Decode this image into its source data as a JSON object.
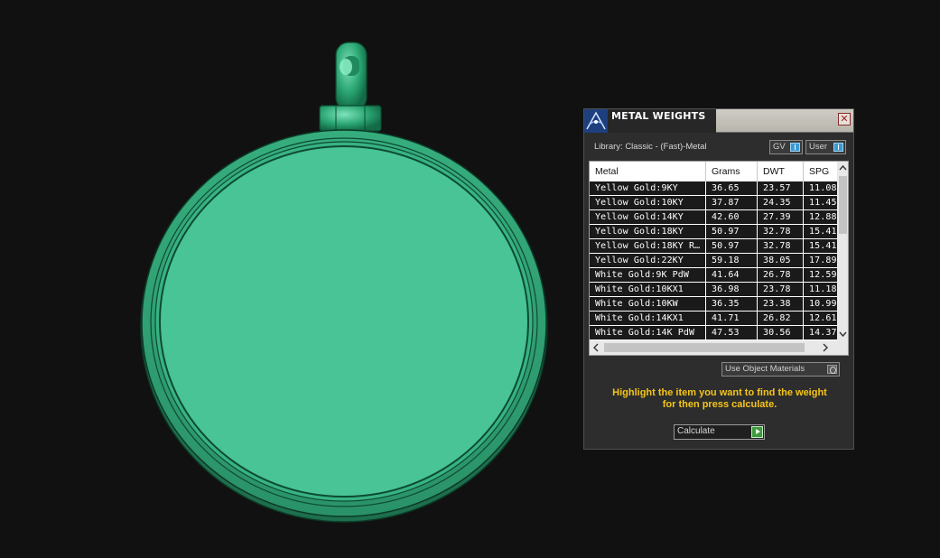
{
  "panel": {
    "title": "METAL WEIGHTS",
    "close_glyph": "✕",
    "library_label": "Library: Classic - (Fast)-Metal",
    "toggle_gv": "GV",
    "toggle_user": "User",
    "columns": [
      "Metal",
      "Grams",
      "DWT",
      "SPG"
    ],
    "rows": [
      {
        "metal": "Yellow Gold:9KY",
        "grams": "36.65",
        "dwt": "23.57",
        "spg": "11.08"
      },
      {
        "metal": "Yellow Gold:10KY",
        "grams": "37.87",
        "dwt": "24.35",
        "spg": "11.45"
      },
      {
        "metal": "Yellow Gold:14KY",
        "grams": "42.60",
        "dwt": "27.39",
        "spg": "12.88"
      },
      {
        "metal": "Yellow Gold:18KY",
        "grams": "50.97",
        "dwt": "32.78",
        "spg": "15.41"
      },
      {
        "metal": "Yellow Gold:18KY R...",
        "grams": "50.97",
        "dwt": "32.78",
        "spg": "15.41"
      },
      {
        "metal": "Yellow Gold:22KY",
        "grams": "59.18",
        "dwt": "38.05",
        "spg": "17.89"
      },
      {
        "metal": "White Gold:9K PdW",
        "grams": "41.64",
        "dwt": "26.78",
        "spg": "12.59"
      },
      {
        "metal": "White Gold:10KX1",
        "grams": "36.98",
        "dwt": "23.78",
        "spg": "11.18"
      },
      {
        "metal": "White Gold:10KW",
        "grams": "36.35",
        "dwt": "23.38",
        "spg": "10.99"
      },
      {
        "metal": "White Gold:14KX1",
        "grams": "41.71",
        "dwt": "26.82",
        "spg": "12.61"
      },
      {
        "metal": "White Gold:14K PdW",
        "grams": "47.53",
        "dwt": "30.56",
        "spg": "14.37"
      }
    ],
    "use_object_materials": "Use Object Materials",
    "instruction_line1": "Highlight the item you want to find the weight",
    "instruction_line2": "for then press calculate.",
    "calculate_label": "Calculate"
  },
  "icons": {
    "app": "app-logo-icon",
    "close": "close-icon",
    "scroll_up": "chevron-up-icon",
    "scroll_down": "chevron-down-icon",
    "scroll_left": "chevron-left-icon",
    "scroll_right": "chevron-right-icon",
    "play": "play-icon"
  },
  "colors": {
    "pendant": "#48c496",
    "instruction": "#f5c518",
    "toggle_on": "#3c9ad3",
    "calculate": "#3b9c3b"
  }
}
